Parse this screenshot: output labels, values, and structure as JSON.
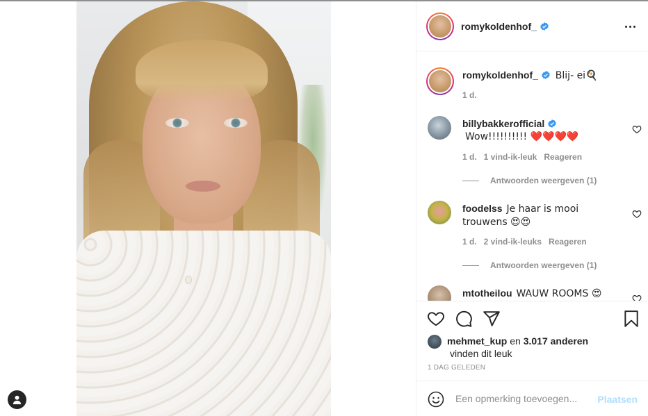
{
  "post": {
    "author": "romykoldenhof_",
    "more_label": "…"
  },
  "comments": [
    {
      "user": "romykoldenhof_",
      "verified": true,
      "text": "Blij- ei🍳",
      "time": "1 d."
    },
    {
      "user": "billybakkerofficial",
      "verified": true,
      "text": "Wow!!!!!!!!!! ❤️❤️❤️❤️",
      "time": "1 d.",
      "likes": "1 vind-ik-leuk",
      "reply": "Reageren",
      "view_replies": "Antwoorden weergeven (1)"
    },
    {
      "user": "foodelss",
      "verified": false,
      "text": "Je haar is mooi trouwens 😍😍",
      "time": "1 d.",
      "likes": "2 vind-ik-leuks",
      "reply": "Reageren",
      "view_replies": "Antwoorden weergeven (1)"
    },
    {
      "user": "mtotheilou",
      "verified": false,
      "text": "WAUW ROOMS 😍 wat"
    }
  ],
  "likes": {
    "user": "mehmet_kup",
    "joiner": "en",
    "count": "3.017 anderen",
    "suffix": "vinden dit leuk"
  },
  "timestamp": "1 DAG GELEDEN",
  "add_comment": {
    "placeholder": "Een opmerking toevoegen...",
    "post_label": "Plaatsen"
  },
  "colors": {
    "verified": "#3897f0",
    "muted": "#8e8e8e",
    "post_disabled": "#b2dffc"
  }
}
